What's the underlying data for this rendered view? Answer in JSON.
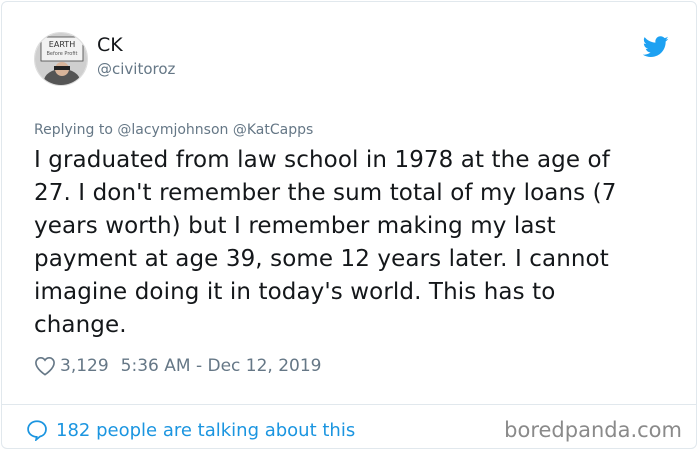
{
  "user": {
    "display_name": "CK",
    "handle": "@civitoroz",
    "avatar_sign_text": "EARTH",
    "avatar_sign_sub": "Before Profit"
  },
  "tweet": {
    "replying_to": "Replying to @lacymjohnson @KatCapps",
    "lines": [
      "I graduated from law school in 1978 at the age of",
      "27. I don't remember the sum total of my loans (7",
      "years worth) but I remember making my last",
      "payment at age 39, some 12 years later. I cannot",
      "imagine doing it in today's world. This has to",
      "change."
    ],
    "likes": "3,129",
    "timestamp": "5:36 AM - Dec 12, 2019"
  },
  "footer": {
    "talking": "182 people are talking about this",
    "brand": "boredpanda.com"
  },
  "colors": {
    "twitter_blue": "#1da1f2",
    "link_blue": "#1b95e0",
    "muted": "#657786"
  }
}
